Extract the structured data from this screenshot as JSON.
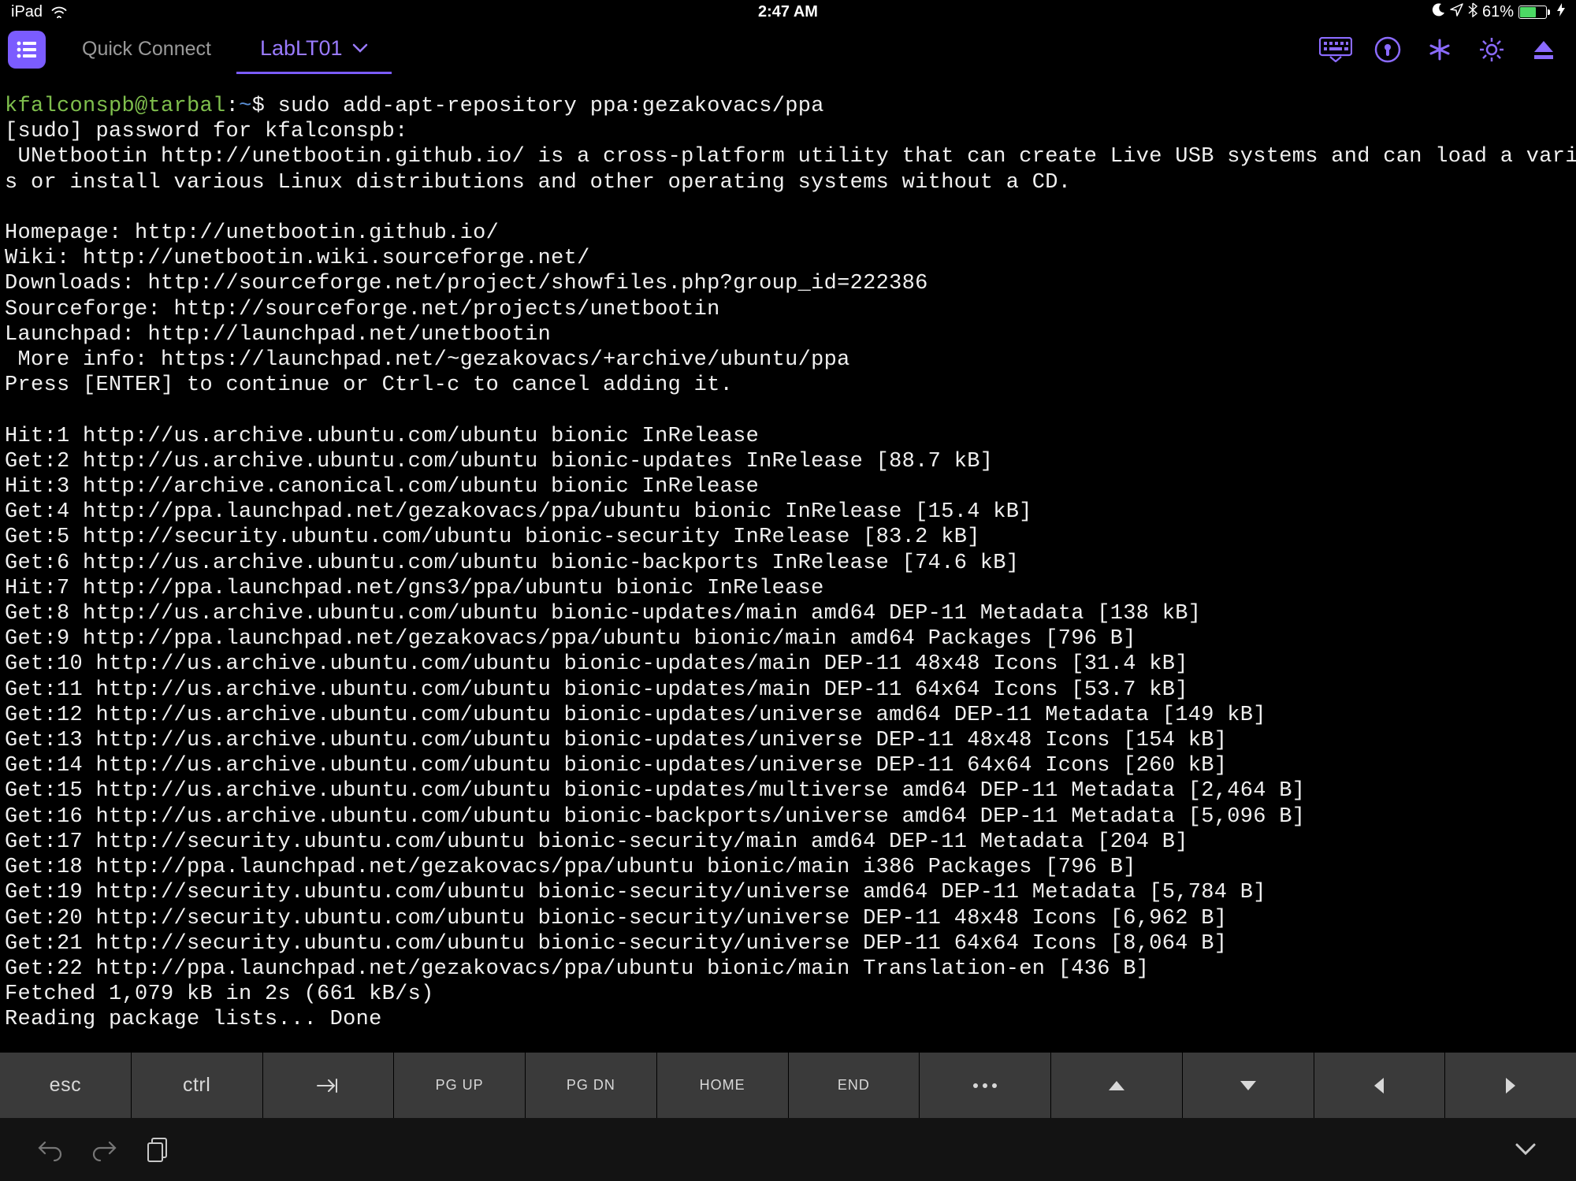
{
  "status": {
    "device": "iPad",
    "time": "2:47 AM",
    "battery_pct": "61%"
  },
  "toolbar": {
    "quick_connect": "Quick Connect",
    "tab_name": "LabLT01"
  },
  "terminal": {
    "user": "kfalconspb",
    "at": "@",
    "host": "tarbal",
    "colon": ":",
    "path": "~",
    "dollar": "$ ",
    "command": "sudo add-apt-repository ppa:gezakovacs/ppa",
    "lines": [
      "[sudo] password for kfalconspb:",
      " UNetbootin http://unetbootin.github.io/ is a cross-platform utility that can create Live USB systems and can load a variety of system utilitie",
      "s or install various Linux distributions and other operating systems without a CD.",
      "",
      "Homepage: http://unetbootin.github.io/",
      "Wiki: http://unetbootin.wiki.sourceforge.net/",
      "Downloads: http://sourceforge.net/project/showfiles.php?group_id=222386",
      "Sourceforge: http://sourceforge.net/projects/unetbootin",
      "Launchpad: http://launchpad.net/unetbootin",
      " More info: https://launchpad.net/~gezakovacs/+archive/ubuntu/ppa",
      "Press [ENTER] to continue or Ctrl-c to cancel adding it.",
      "",
      "Hit:1 http://us.archive.ubuntu.com/ubuntu bionic InRelease",
      "Get:2 http://us.archive.ubuntu.com/ubuntu bionic-updates InRelease [88.7 kB]",
      "Hit:3 http://archive.canonical.com/ubuntu bionic InRelease",
      "Get:4 http://ppa.launchpad.net/gezakovacs/ppa/ubuntu bionic InRelease [15.4 kB]",
      "Get:5 http://security.ubuntu.com/ubuntu bionic-security InRelease [83.2 kB]",
      "Get:6 http://us.archive.ubuntu.com/ubuntu bionic-backports InRelease [74.6 kB]",
      "Hit:7 http://ppa.launchpad.net/gns3/ppa/ubuntu bionic InRelease",
      "Get:8 http://us.archive.ubuntu.com/ubuntu bionic-updates/main amd64 DEP-11 Metadata [138 kB]",
      "Get:9 http://ppa.launchpad.net/gezakovacs/ppa/ubuntu bionic/main amd64 Packages [796 B]",
      "Get:10 http://us.archive.ubuntu.com/ubuntu bionic-updates/main DEP-11 48x48 Icons [31.4 kB]",
      "Get:11 http://us.archive.ubuntu.com/ubuntu bionic-updates/main DEP-11 64x64 Icons [53.7 kB]",
      "Get:12 http://us.archive.ubuntu.com/ubuntu bionic-updates/universe amd64 DEP-11 Metadata [149 kB]",
      "Get:13 http://us.archive.ubuntu.com/ubuntu bionic-updates/universe DEP-11 48x48 Icons [154 kB]",
      "Get:14 http://us.archive.ubuntu.com/ubuntu bionic-updates/universe DEP-11 64x64 Icons [260 kB]",
      "Get:15 http://us.archive.ubuntu.com/ubuntu bionic-updates/multiverse amd64 DEP-11 Metadata [2,464 B]",
      "Get:16 http://us.archive.ubuntu.com/ubuntu bionic-backports/universe amd64 DEP-11 Metadata [5,096 B]",
      "Get:17 http://security.ubuntu.com/ubuntu bionic-security/main amd64 DEP-11 Metadata [204 B]",
      "Get:18 http://ppa.launchpad.net/gezakovacs/ppa/ubuntu bionic/main i386 Packages [796 B]",
      "Get:19 http://security.ubuntu.com/ubuntu bionic-security/universe amd64 DEP-11 Metadata [5,784 B]",
      "Get:20 http://security.ubuntu.com/ubuntu bionic-security/universe DEP-11 48x48 Icons [6,962 B]",
      "Get:21 http://security.ubuntu.com/ubuntu bionic-security/universe DEP-11 64x64 Icons [8,064 B]",
      "Get:22 http://ppa.launchpad.net/gezakovacs/ppa/ubuntu bionic/main Translation-en [436 B]",
      "Fetched 1,079 kB in 2s (661 kB/s)",
      "Reading package lists... Done"
    ]
  },
  "keys": {
    "esc": "esc",
    "ctrl": "ctrl",
    "pgup": "PG UP",
    "pgdn": "PG DN",
    "home": "HOME",
    "end": "END"
  }
}
